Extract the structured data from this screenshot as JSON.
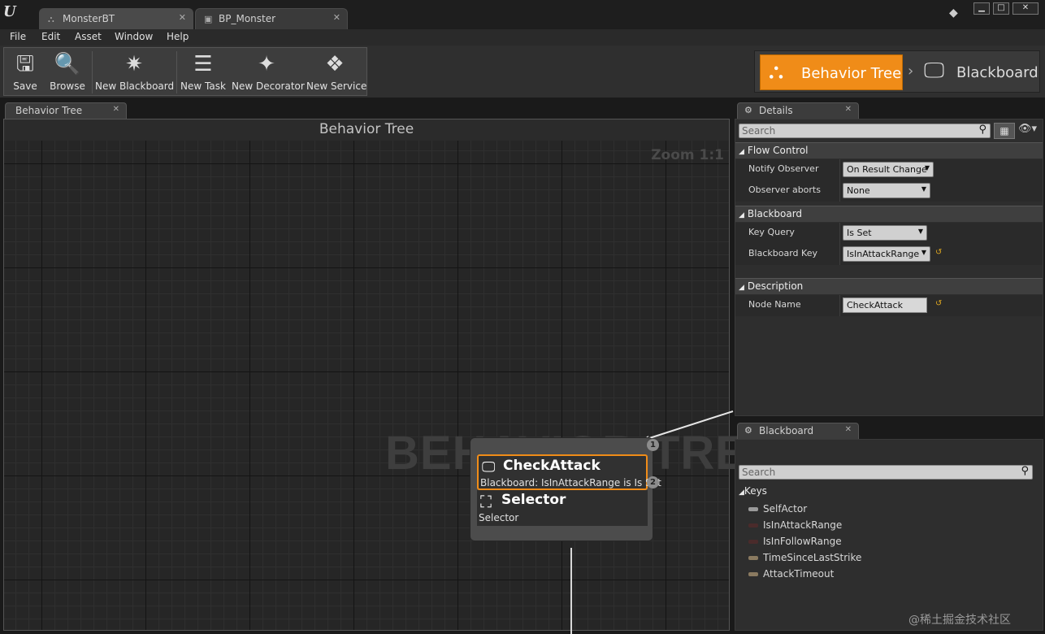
{
  "window": {
    "tabs": [
      {
        "label": "MonsterBT",
        "icon": "behavior-tree-icon"
      },
      {
        "label": "BP_Monster",
        "icon": "blueprint-icon"
      }
    ],
    "controls": {
      "minimize": "▁",
      "maximize": "□",
      "close": "✕"
    }
  },
  "menu": [
    "File",
    "Edit",
    "Asset",
    "Window",
    "Help"
  ],
  "toolbar": {
    "save": "Save",
    "browse": "Browse",
    "new_blackboard": "New Blackboard",
    "new_task": "New Task",
    "new_decorator": "New Decorator",
    "new_service": "New Service"
  },
  "modes": {
    "behavior_tree": "Behavior Tree",
    "blackboard": "Blackboard",
    "active": "behavior_tree",
    "accent": "#f08c18"
  },
  "graph": {
    "tab_label": "Behavior Tree",
    "title": "Behavior Tree",
    "zoom": "Zoom 1:1",
    "watermark": "BEHAVIOR TREE",
    "node": {
      "decorator_title": "CheckAttack",
      "decorator_desc": "Blackboard: IsInAttackRange is Is Set",
      "composite_title": "Selector",
      "composite_desc": "Selector",
      "index_top": "1",
      "index_decorator": "2"
    }
  },
  "details": {
    "tab_label": "Details",
    "search_placeholder": "Search",
    "sections": {
      "flow_control": "Flow Control",
      "blackboard": "Blackboard",
      "description": "Description"
    },
    "notify_observer": {
      "label": "Notify Observer",
      "value": "On Result Change"
    },
    "observer_aborts": {
      "label": "Observer aborts",
      "value": "None"
    },
    "key_query": {
      "label": "Key Query",
      "value": "Is Set"
    },
    "blackboard_key": {
      "label": "Blackboard Key",
      "value": "IsInAttackRange"
    },
    "node_name": {
      "label": "Node Name",
      "value": "CheckAttack"
    }
  },
  "blackboard_panel": {
    "tab_label": "Blackboard",
    "search_placeholder": "Search",
    "keys_header": "Keys",
    "keys": [
      "SelfActor",
      "IsInAttackRange",
      "IsInFollowRange",
      "TimeSinceLastStrike",
      "AttackTimeout"
    ]
  },
  "credit": "@稀土掘金技术社区"
}
